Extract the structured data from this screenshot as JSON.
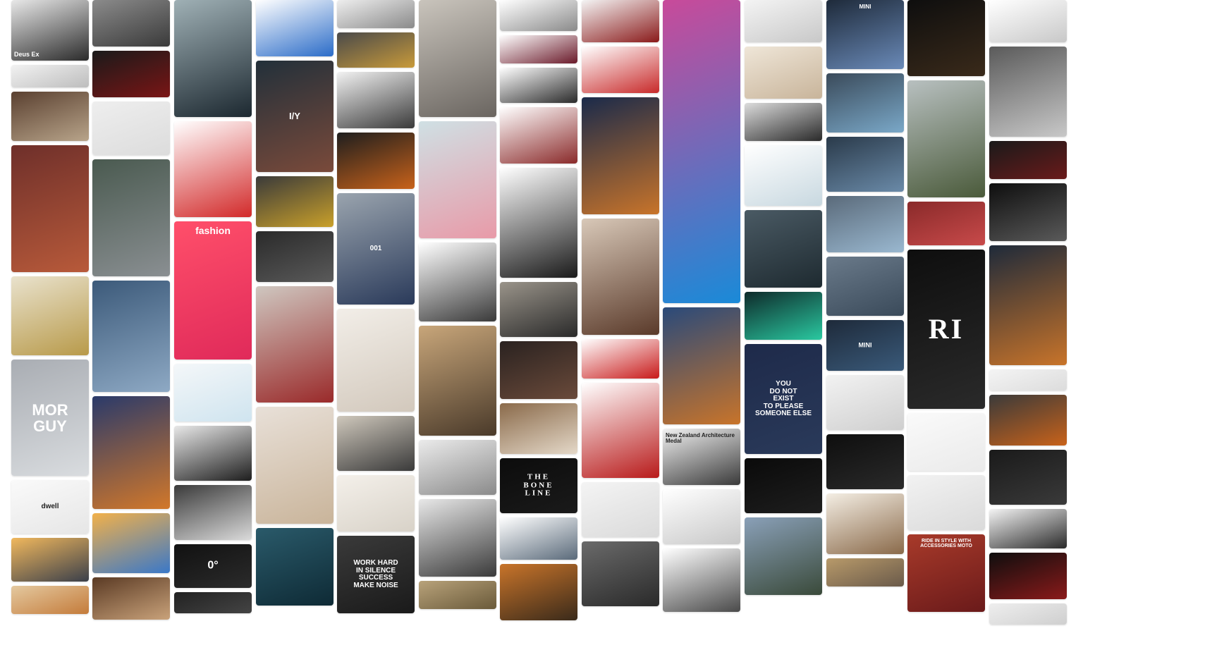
{
  "columns": [
    {
      "tiles": [
        {
          "name": "drone-sketch-tile",
          "h": 86,
          "g": [
            "#e8e8e8",
            "#2b2b2b"
          ],
          "text": "Deus Ex",
          "tpos": "bottom",
          "fs": 9,
          "ta": "left"
        },
        {
          "name": "car-sketch-tile",
          "h": 32,
          "g": [
            "#f2f2f2",
            "#bdbdbd"
          ]
        },
        {
          "name": "rings-tile",
          "h": 70,
          "g": [
            "#5a4030",
            "#b8a48a"
          ]
        },
        {
          "name": "woman-portrait-illustration-tile",
          "h": 180,
          "g": [
            "#6e2f2a",
            "#b85a3a"
          ]
        },
        {
          "name": "doodle-notebook-tile",
          "h": 112,
          "g": [
            "#e9e2cd",
            "#b89a4a"
          ]
        },
        {
          "name": "mor-guy-poster-tile",
          "h": 165,
          "g": [
            "#a9adb3",
            "#d9dcdf"
          ],
          "text": "MOR\nGUY",
          "tpos": "center",
          "fs": 22
        },
        {
          "name": "dwell-packaging-tile",
          "h": 76,
          "g": [
            "#fafafa",
            "#e6e6e6"
          ],
          "text": "dwell",
          "tpos": "center",
          "fs": 10,
          "dark": true
        },
        {
          "name": "sunset-planet-tile",
          "h": 62,
          "g": [
            "#f1b85d",
            "#3a3f4a"
          ]
        },
        {
          "name": "face-portrait-tile",
          "h": 40,
          "g": [
            "#e4c9a0",
            "#c47b3a"
          ]
        }
      ]
    },
    {
      "tiles": [
        {
          "name": "bicycle-tile",
          "h": 66,
          "g": [
            "#8b8b8b",
            "#3a3a3a"
          ]
        },
        {
          "name": "red-concept-car-tile",
          "h": 66,
          "g": [
            "#1a1a1a",
            "#7a1515"
          ]
        },
        {
          "name": "logo-mark-tile",
          "h": 76,
          "g": [
            "#eeeeee",
            "#dcdcdc"
          ]
        },
        {
          "name": "train-tile",
          "h": 166,
          "g": [
            "#4a5a50",
            "#8a8f92"
          ]
        },
        {
          "name": "glass-building-tile",
          "h": 158,
          "g": [
            "#3c5a7a",
            "#8ea9c4"
          ]
        },
        {
          "name": "fantasy-throne-tile",
          "h": 160,
          "g": [
            "#2a3a6a",
            "#d2782a"
          ]
        },
        {
          "name": "weather-app-tile",
          "h": 85,
          "g": [
            "#f2b14a",
            "#3a78c8"
          ]
        },
        {
          "name": "wooden-house-tile",
          "h": 60,
          "g": [
            "#5a3a24",
            "#c9a27a"
          ]
        }
      ]
    },
    {
      "tiles": [
        {
          "name": "underwater-iceberg-tile",
          "h": 166,
          "g": [
            "#9fb0b5",
            "#1c2830"
          ]
        },
        {
          "name": "red-racer-sketches-tile",
          "h": 136,
          "g": [
            "#ffffff",
            "#d22a2a"
          ]
        },
        {
          "name": "fashion-website-tile",
          "h": 196,
          "g": [
            "#ff4f6a",
            "#e02a5a"
          ],
          "text": "fashion",
          "tpos": "top",
          "fs": 14
        },
        {
          "name": "icon-pattern-tile",
          "h": 82,
          "g": [
            "#f4f7f9",
            "#cfe4ef"
          ]
        },
        {
          "name": "dark-brochure-tile",
          "h": 78,
          "g": [
            "#e8e8e8",
            "#1e1e1e"
          ]
        },
        {
          "name": "sketchbook-tile",
          "h": 78,
          "g": [
            "#3a3a3a",
            "#dadada"
          ]
        },
        {
          "name": "zero-degrees-brand-tile",
          "h": 62,
          "g": [
            "#111111",
            "#2b2b2b"
          ],
          "text": "0°",
          "tpos": "center",
          "fs": 16
        },
        {
          "name": "dark-card-tile",
          "h": 30,
          "g": [
            "#222222",
            "#444444"
          ]
        }
      ]
    },
    {
      "tiles": [
        {
          "name": "vr-headset-tile",
          "h": 80,
          "g": [
            "#ffffff",
            "#2b6cc8"
          ]
        },
        {
          "name": "calendar-poster-tile",
          "h": 158,
          "g": [
            "#22303a",
            "#7a4a3a"
          ],
          "text": "I/Y",
          "tpos": "center",
          "fs": 13
        },
        {
          "name": "yellow-truck-tile",
          "h": 72,
          "g": [
            "#3a3a3a",
            "#c9a02a"
          ]
        },
        {
          "name": "watch-tile",
          "h": 72,
          "g": [
            "#2a2a2a",
            "#5a5a5a"
          ]
        },
        {
          "name": "bearded-man-tile",
          "h": 165,
          "g": [
            "#cfc7c0",
            "#9a2a2a"
          ]
        },
        {
          "name": "blonde-woman-tile",
          "h": 166,
          "g": [
            "#e8e0d8",
            "#c9b49a"
          ]
        },
        {
          "name": "sharks-underwater-tile",
          "h": 110,
          "g": [
            "#2a5a6a",
            "#0e2a35"
          ]
        }
      ]
    },
    {
      "tiles": [
        {
          "name": "jet-car-tile",
          "h": 40,
          "g": [
            "#eeeeee",
            "#8a8a8a"
          ]
        },
        {
          "name": "gold-sports-car-tile",
          "h": 50,
          "g": [
            "#4a4a4a",
            "#c89a3a"
          ]
        },
        {
          "name": "motorcycle-tile",
          "h": 80,
          "g": [
            "#f2f2f2",
            "#3a3a3a"
          ]
        },
        {
          "name": "orange-suv-tile",
          "h": 80,
          "g": [
            "#1e1e1e",
            "#c8621a"
          ]
        },
        {
          "name": "top-view-car-tile",
          "h": 158,
          "g": [
            "#9aa4ae",
            "#2a3a5a"
          ],
          "text": "001",
          "tpos": "center",
          "fs": 10
        },
        {
          "name": "minimal-room-tile",
          "h": 146,
          "g": [
            "#f2eee8",
            "#d2c8bc"
          ]
        },
        {
          "name": "framed-prints-tile",
          "h": 78,
          "g": [
            "#cfc8bc",
            "#3a3a3a"
          ]
        },
        {
          "name": "stationery-shapes-tile",
          "h": 80,
          "g": [
            "#f4f0ea",
            "#d8d2c8"
          ]
        },
        {
          "name": "work-hard-poster-tile",
          "h": 110,
          "g": [
            "#3a3a3a",
            "#1a1a1a"
          ],
          "text": "WORK HARD\nIN SILENCE\nSUCCESS\nMAKE NOISE",
          "tpos": "center",
          "fs": 10
        }
      ]
    },
    {
      "tiles": [
        {
          "name": "bathroom-tile",
          "h": 166,
          "g": [
            "#c9c4bc",
            "#6a6560"
          ]
        },
        {
          "name": "pink-hair-illustration-tile",
          "h": 166,
          "g": [
            "#cfe0e4",
            "#e89aa8"
          ]
        },
        {
          "name": "audi-sketch-tile",
          "h": 112,
          "g": [
            "#ffffff",
            "#3a3a3a"
          ]
        },
        {
          "name": "lowpoly-lion-tile",
          "h": 156,
          "g": [
            "#c8a67a",
            "#4a3a2a"
          ]
        },
        {
          "name": "magazine-spread-tile",
          "h": 78,
          "g": [
            "#ebebeb",
            "#8a8a8a"
          ]
        },
        {
          "name": "bikini-woman-tile",
          "h": 110,
          "g": [
            "#e8e8e8",
            "#3a3a3a"
          ]
        },
        {
          "name": "interior-room-tile",
          "h": 40,
          "g": [
            "#b8a27a",
            "#6a5a3a"
          ]
        }
      ]
    },
    {
      "tiles": [
        {
          "name": "silver-car-tile",
          "h": 44,
          "g": [
            "#ffffff",
            "#8a8a8a"
          ]
        },
        {
          "name": "maroon-car-tile",
          "h": 40,
          "g": [
            "#ffffff",
            "#6a1a2a"
          ]
        },
        {
          "name": "black-car-tile",
          "h": 50,
          "g": [
            "#ffffff",
            "#2a2a2a"
          ]
        },
        {
          "name": "character-lineup-tile",
          "h": 80,
          "g": [
            "#ffffff",
            "#8a2a2a"
          ]
        },
        {
          "name": "ink-face-tile",
          "h": 156,
          "g": [
            "#ffffff",
            "#1a1a1a"
          ]
        },
        {
          "name": "folding-knife-tile",
          "h": 78,
          "g": [
            "#9a948a",
            "#2a2a2a"
          ]
        },
        {
          "name": "leather-tools-tile",
          "h": 82,
          "g": [
            "#2a2220",
            "#6a4a3a"
          ]
        },
        {
          "name": "string-art-tile",
          "h": 72,
          "g": [
            "#8a6a4a",
            "#e4d8c8"
          ]
        },
        {
          "name": "the-bone-line-tile",
          "h": 78,
          "g": [
            "#0c0c0c",
            "#1a1a1a"
          ],
          "text": "THE\nBONE\nLINE",
          "tpos": "center",
          "fs": 11,
          "serif": true
        },
        {
          "name": "bmw-sketch-tile",
          "h": 60,
          "g": [
            "#ffffff",
            "#5a6a7a"
          ]
        },
        {
          "name": "star-wars-sketch-tile",
          "h": 80,
          "g": [
            "#c8742a",
            "#3a2a1a"
          ]
        }
      ]
    },
    {
      "tiles": [
        {
          "name": "futuristic-bike-tile",
          "h": 60,
          "g": [
            "#f4f4f4",
            "#8a1a1a"
          ]
        },
        {
          "name": "race-car-sketch-tile",
          "h": 66,
          "g": [
            "#ffffff",
            "#c82a2a"
          ]
        },
        {
          "name": "moon-nebula-tile",
          "h": 166,
          "g": [
            "#1a2a4a",
            "#c8742a"
          ]
        },
        {
          "name": "flower-crown-tile",
          "h": 165,
          "g": [
            "#d8c8b8",
            "#5a3a2a"
          ]
        },
        {
          "name": "red-car-render-tile",
          "h": 56,
          "g": [
            "#ffffff",
            "#c81a1a"
          ]
        },
        {
          "name": "woman-red-top-tile",
          "h": 135,
          "g": [
            "#ffffff",
            "#b81a1a"
          ]
        },
        {
          "name": "product-boxes-tile",
          "h": 78,
          "g": [
            "#f4f4f4",
            "#dadada"
          ]
        },
        {
          "name": "dark-pants-tile",
          "h": 92,
          "g": [
            "#6a6a6a",
            "#2a2a2a"
          ]
        }
      ]
    },
    {
      "tiles": [
        {
          "name": "landing-page-tile",
          "h": 430,
          "g": [
            "#c84a9a",
            "#1a8ad8"
          ]
        },
        {
          "name": "modern-house-tile",
          "h": 166,
          "g": [
            "#2a4a7a",
            "#c8742a"
          ]
        },
        {
          "name": "nz-architecture-book-tile",
          "h": 80,
          "g": [
            "#f2f2f2",
            "#3a3a3a"
          ],
          "text": "New Zealand Architecture Medal",
          "tpos": "top",
          "fs": 8,
          "dark": true,
          "ta": "left"
        },
        {
          "name": "kung-fu-sketch-tile",
          "h": 78,
          "g": [
            "#ffffff",
            "#c8c8c8"
          ]
        },
        {
          "name": "multitool-tile",
          "h": 90,
          "g": [
            "#ffffff",
            "#4a4a4a"
          ]
        }
      ]
    },
    {
      "tiles": [
        {
          "name": "bottles-product-tile",
          "h": 60,
          "g": [
            "#f4f4f4",
            "#c8c8c8"
          ]
        },
        {
          "name": "white-lion-tile",
          "h": 74,
          "g": [
            "#efe6d8",
            "#c8b49a"
          ]
        },
        {
          "name": "dark-car-sketch-tile",
          "h": 54,
          "g": [
            "#dcdcdc",
            "#2a2a2a"
          ]
        },
        {
          "name": "kitchen-appliance-tile",
          "h": 86,
          "g": [
            "#ffffff",
            "#c8d8e0"
          ]
        },
        {
          "name": "cat-stairs-tile",
          "h": 110,
          "g": [
            "#4a5a64",
            "#1e2a30"
          ]
        },
        {
          "name": "aurora-tile",
          "h": 68,
          "g": [
            "#0e2a2a",
            "#2ac8a0"
          ]
        },
        {
          "name": "you-do-not-exist-poster-tile",
          "h": 156,
          "g": [
            "#1e2a4a",
            "#2a3a5a"
          ],
          "text": "YOU\nDO NOT\nEXIST\nTO PLEASE\nSOMEONE ELSE",
          "tpos": "center",
          "fs": 10
        },
        {
          "name": "wine-bottles-tile",
          "h": 78,
          "g": [
            "#0a0a0a",
            "#1e1e1e"
          ]
        },
        {
          "name": "glass-house-tile",
          "h": 110,
          "g": [
            "#8aa0b8",
            "#3a4a3a"
          ]
        }
      ]
    },
    {
      "tiles": [
        {
          "name": "mini-car-garage-tile",
          "h": 98,
          "g": [
            "#1e2a3a",
            "#6a8ab8"
          ],
          "text": "MINI",
          "tpos": "top",
          "fs": 8
        },
        {
          "name": "mini-car-front-tile",
          "h": 84,
          "g": [
            "#3a4a5a",
            "#7aa8c8"
          ]
        },
        {
          "name": "mini-car-side-tile",
          "h": 78,
          "g": [
            "#2a3a4a",
            "#6a8aa8"
          ]
        },
        {
          "name": "mini-convertible-tile",
          "h": 80,
          "g": [
            "#5a6a7a",
            "#9ab8d0"
          ]
        },
        {
          "name": "mini-interior-tile",
          "h": 84,
          "g": [
            "#6a7a8a",
            "#3a4a5a"
          ]
        },
        {
          "name": "mini-superleggera-tile",
          "h": 72,
          "g": [
            "#1e2a3a",
            "#3a5a7a"
          ],
          "text": "MINI",
          "tpos": "center",
          "fs": 9
        },
        {
          "name": "brochure-layout-tile",
          "h": 78,
          "g": [
            "#f2f2f2",
            "#cfcfcf"
          ]
        },
        {
          "name": "dark-bottles-tile",
          "h": 78,
          "g": [
            "#0e0e0e",
            "#2a2a2a"
          ]
        },
        {
          "name": "concept-car-sketch-tile",
          "h": 86,
          "g": [
            "#f4eee4",
            "#8a6a4a"
          ]
        },
        {
          "name": "house-interior-tile",
          "h": 40,
          "g": [
            "#b89a6a",
            "#6a5a4a"
          ]
        }
      ]
    },
    {
      "tiles": [
        {
          "name": "pc-case-tile",
          "h": 108,
          "g": [
            "#0e0e0e",
            "#3a2a1a"
          ]
        },
        {
          "name": "rope-bridge-tile",
          "h": 166,
          "g": [
            "#b8c0c0",
            "#4a5a3a"
          ]
        },
        {
          "name": "red-fog-figure-tile",
          "h": 62,
          "g": [
            "#8a2a2a",
            "#c84a4a"
          ]
        },
        {
          "name": "ornate-typography-tile",
          "h": 226,
          "g": [
            "#0e0e0e",
            "#2a2a2a"
          ],
          "text": "RI",
          "tpos": "center",
          "fs": 40,
          "serif": true
        },
        {
          "name": "hot-sauce-tile",
          "h": 82,
          "g": [
            "#fafafa",
            "#eaeaea"
          ]
        },
        {
          "name": "packaging-diagram-tile",
          "h": 78,
          "g": [
            "#f2f2f2",
            "#dadada"
          ]
        },
        {
          "name": "ride-in-style-poster-tile",
          "h": 110,
          "g": [
            "#a83a2a",
            "#6a1a1a"
          ],
          "text": "RIDE IN STYLE WITH\nACCESSORIES MOTO",
          "tpos": "top",
          "fs": 7
        }
      ]
    },
    {
      "tiles": [
        {
          "name": "volvo-truck-tile",
          "h": 60,
          "g": [
            "#ffffff",
            "#c8c8c8"
          ]
        },
        {
          "name": "aircraft-tile",
          "h": 128,
          "g": [
            "#5a5a5a",
            "#c8c8c8"
          ]
        },
        {
          "name": "dark-motorcycle-tile",
          "h": 54,
          "g": [
            "#1a1a1a",
            "#6a1a1a"
          ]
        },
        {
          "name": "digital-recorder-tile",
          "h": 82,
          "g": [
            "#0e0e0e",
            "#5a5a5a"
          ]
        },
        {
          "name": "bokeh-lights-tile",
          "h": 170,
          "g": [
            "#1e2a3a",
            "#c8742a"
          ]
        },
        {
          "name": "document-pages-tile",
          "h": 30,
          "g": [
            "#f4f4f4",
            "#dcdcdc"
          ]
        },
        {
          "name": "orange-wire-art-tile",
          "h": 72,
          "g": [
            "#3a3a3a",
            "#c8621a"
          ]
        },
        {
          "name": "black-gadget-tile",
          "h": 78,
          "g": [
            "#1a1a1a",
            "#3a3a3a"
          ]
        },
        {
          "name": "hover-car-tile",
          "h": 56,
          "g": [
            "#f4f4f4",
            "#2a2a2a"
          ]
        },
        {
          "name": "red-sports-car-tile",
          "h": 66,
          "g": [
            "#0e0e0e",
            "#8a1a1a"
          ]
        },
        {
          "name": "light-card-tile",
          "h": 30,
          "g": [
            "#eeeeee",
            "#cfcfcf"
          ]
        }
      ]
    }
  ]
}
